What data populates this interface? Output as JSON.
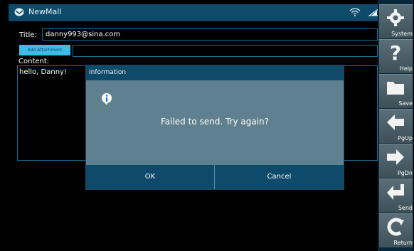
{
  "window": {
    "title": "NewMall"
  },
  "compose": {
    "title_label": "Title:",
    "title_value": "danny993@sina.com",
    "attach_label": "Add Attachment",
    "content_label": "Content:",
    "content_value": "hello, Danny!"
  },
  "dialog": {
    "title": "Information",
    "message": "Failed to send. Try again?",
    "ok_label": "OK",
    "cancel_label": "Cancel"
  },
  "sidebar": {
    "items": [
      {
        "label": "System",
        "icon": "gear-icon"
      },
      {
        "label": "Help",
        "icon": "question-icon"
      },
      {
        "label": "Save",
        "icon": "folder-icon"
      },
      {
        "label": "PgUp",
        "icon": "arrow-left-icon"
      },
      {
        "label": "PgDn",
        "icon": "arrow-right-icon"
      },
      {
        "label": "Send",
        "icon": "enter-icon"
      },
      {
        "label": "Return",
        "icon": "return-icon"
      }
    ]
  },
  "colors": {
    "titlebar": "#0e4a6a",
    "accent": "#3dbbe9",
    "dialog_body": "#5f808e",
    "sidebar_button": "#4f636c"
  }
}
